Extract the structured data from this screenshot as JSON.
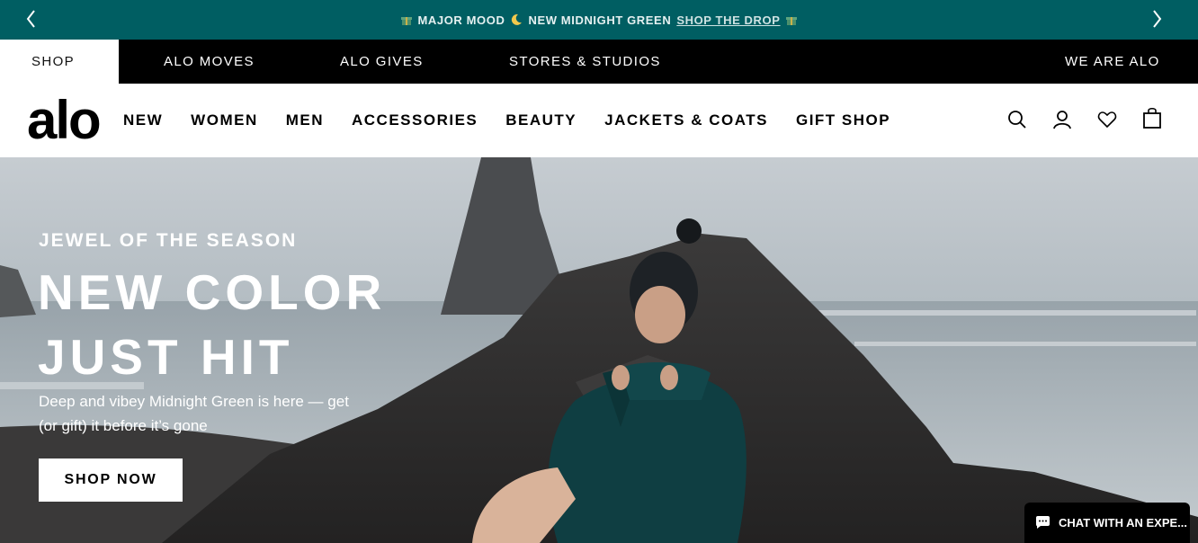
{
  "promo": {
    "left_icon": "gift-icon",
    "text_a": "MAJOR MOOD",
    "moon_icon": "moon-icon",
    "text_b": "NEW MIDNIGHT GREEN",
    "link": "SHOP THE DROP",
    "right_icon": "gift-icon",
    "prev_icon": "chevron-left-icon",
    "next_icon": "chevron-right-icon",
    "bg_color": "#005e62"
  },
  "topnav": {
    "shop": "SHOP",
    "alo_moves": "ALO MOVES",
    "alo_gives": "ALO GIVES",
    "stores": "STORES & STUDIOS",
    "we_are_alo": "WE ARE ALO"
  },
  "header": {
    "logo": "alo",
    "nav": {
      "new": "NEW",
      "women": "WOMEN",
      "men": "MEN",
      "accessories": "ACCESSORIES",
      "beauty": "BEAUTY",
      "jackets": "JACKETS & COATS",
      "gift_shop": "GIFT SHOP"
    },
    "icons": [
      "search-icon",
      "account-icon",
      "wishlist-heart-icon",
      "shopping-bag-icon"
    ]
  },
  "hero": {
    "eyebrow": "JEWEL OF THE SEASON",
    "headline": "NEW COLOR JUST HIT",
    "subtext": "Deep and vibey Midnight Green is here — get (or gift) it before it’s gone",
    "cta": "SHOP NOW"
  },
  "chat": {
    "icon": "chat-bubble-icon",
    "label": "CHAT WITH AN EXPE..."
  }
}
